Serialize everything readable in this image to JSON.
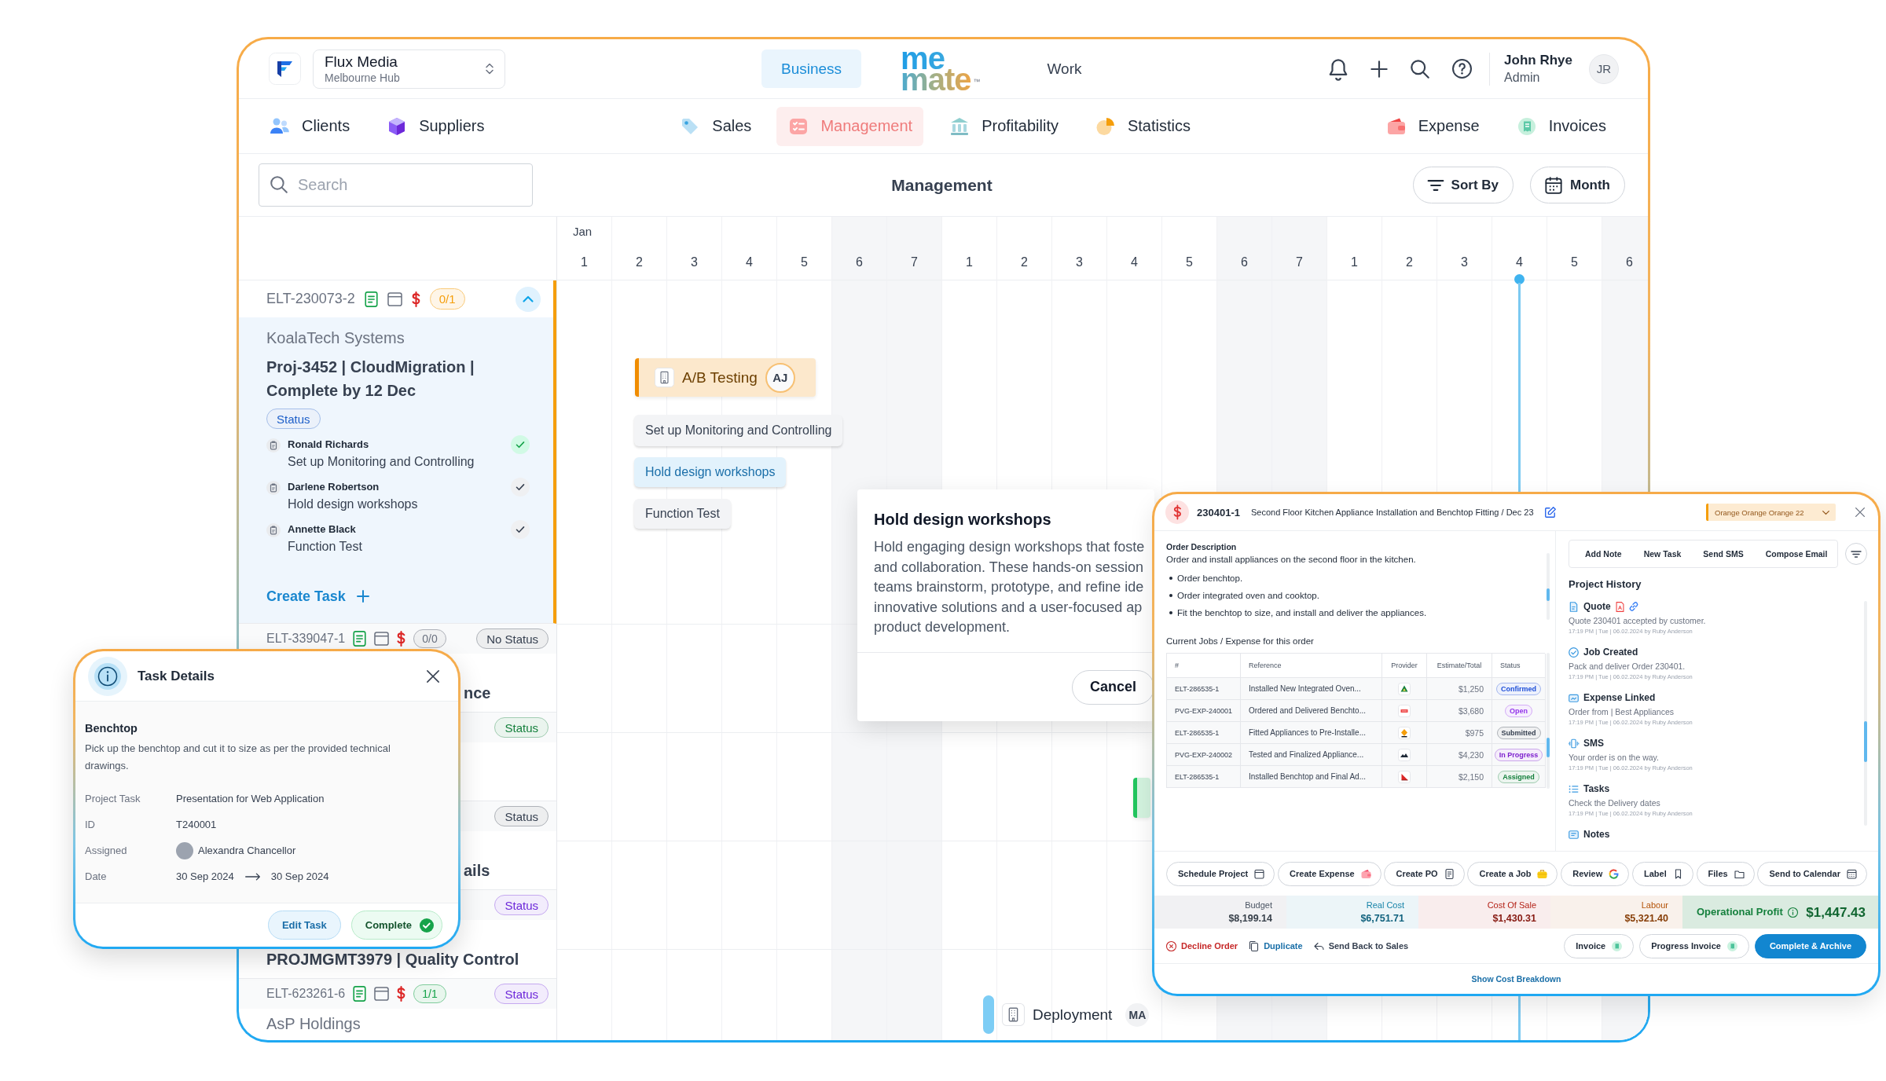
{
  "header": {
    "org": {
      "name": "Flux Media",
      "location": "Melbourne Hub"
    },
    "modes": [
      {
        "label": "Business",
        "selected": true
      },
      {
        "label": "Work",
        "selected": false
      }
    ],
    "logo": {
      "top": "me",
      "bottom": "mate",
      "mark": "™"
    },
    "user": {
      "name": "John Rhye",
      "role": "Admin",
      "initials": "JR"
    }
  },
  "nav": {
    "left": [
      {
        "label": "Clients",
        "selected": false
      },
      {
        "label": "Suppliers",
        "selected": false
      }
    ],
    "center": [
      {
        "label": "Sales",
        "selected": false
      },
      {
        "label": "Management",
        "selected": true
      },
      {
        "label": "Profitability",
        "selected": false
      },
      {
        "label": "Statistics",
        "selected": false
      }
    ],
    "right": [
      {
        "label": "Expense",
        "selected": false
      },
      {
        "label": "Invoices",
        "selected": false
      }
    ]
  },
  "toolbar": {
    "search": {
      "placeholder": "Search"
    },
    "title": "Management",
    "buttons": [
      "Sort By",
      "Month"
    ]
  },
  "timeline": {
    "month": "Jan",
    "days": [
      {
        "label": "1",
        "weekend": false,
        "today": false
      },
      {
        "label": "2",
        "weekend": false,
        "today": false
      },
      {
        "label": "3",
        "weekend": false,
        "today": false
      },
      {
        "label": "4",
        "weekend": false,
        "today": false
      },
      {
        "label": "5",
        "weekend": false,
        "today": false
      },
      {
        "label": "6",
        "weekend": true,
        "today": false
      },
      {
        "label": "7",
        "weekend": true,
        "today": false
      },
      {
        "label": "1",
        "weekend": false,
        "today": false
      },
      {
        "label": "2",
        "weekend": false,
        "today": false
      },
      {
        "label": "3",
        "weekend": false,
        "today": false
      },
      {
        "label": "4",
        "weekend": false,
        "today": false
      },
      {
        "label": "5",
        "weekend": false,
        "today": false
      },
      {
        "label": "6",
        "weekend": true,
        "today": false
      },
      {
        "label": "7",
        "weekend": true,
        "today": false
      },
      {
        "label": "1",
        "weekend": false,
        "today": false
      },
      {
        "label": "2",
        "weekend": false,
        "today": false
      },
      {
        "label": "3",
        "weekend": false,
        "today": false
      },
      {
        "label": "4",
        "weekend": false,
        "today": true
      },
      {
        "label": "5",
        "weekend": false,
        "today": false
      },
      {
        "label": "6",
        "weekend": true,
        "today": false
      }
    ]
  },
  "projects": [
    {
      "id": "ELT-230073-2",
      "badge": {
        "text": "0/1",
        "color": "#f59e0b"
      },
      "expanded": true,
      "client": "KoalaTech Systems",
      "title": "Proj-3452 | CloudMigration | Complete by 12 Dec",
      "status": {
        "text": "Status",
        "color": "#1d5fc9"
      },
      "tasks": [
        {
          "assignee": "Ronald Richards",
          "name": "Set up Monitoring and Controlling",
          "checked": true
        },
        {
          "assignee": "Darlene Robertson",
          "name": "Hold design workshops",
          "checked": false
        },
        {
          "assignee": "Annette Black",
          "name": "Function Test",
          "checked": false
        }
      ],
      "create_label": "Create Task"
    },
    {
      "id": "ELT-339047-1",
      "badge": {
        "text": "0/0",
        "color": "#6b7280"
      },
      "expanded": false,
      "status": {
        "text": "No Status",
        "color": "#374151"
      },
      "title": "nce"
    },
    {
      "expanded": false,
      "status": {
        "text": "Status",
        "color": "#15803d"
      }
    },
    {
      "expanded": false,
      "status": {
        "text": "Status",
        "color": "#374151"
      },
      "title": "ails"
    },
    {
      "expanded": false,
      "status": {
        "text": "Status",
        "color": "#6d28d9"
      },
      "title": "PROJMGMT3979 | Quality Control"
    },
    {
      "id": "ELT-623261-6",
      "badge": {
        "text": "1/1",
        "color": "#16a34a"
      },
      "expanded": false,
      "status": {
        "text": "Status",
        "color": "#6d28d9"
      },
      "client": "AsP Holdings"
    }
  ],
  "gantt_bars": [
    {
      "kind": "milestone",
      "label": "A/B Testing",
      "initials": "AJ",
      "color": "#f08c00",
      "selected": false
    },
    {
      "kind": "task",
      "label": "Set up Monitoring and Controlling",
      "selected": false
    },
    {
      "kind": "task",
      "label": "Hold design workshops",
      "selected": true
    },
    {
      "kind": "task",
      "label": "Function Test",
      "selected": false
    },
    {
      "kind": "milestone",
      "color": "#22c55e",
      "selected": false
    },
    {
      "kind": "event",
      "label": "Deployment",
      "initials": "MA",
      "color": "#7dcdf5",
      "selected": false
    }
  ],
  "task_popover": {
    "title": "Hold design workshops",
    "text": "Hold engaging design workshops that foste\nand collaboration. These hands-on session\nteams brainstorm, prototype, and refine ide\ninnovative solutions and a user-focused ap\nproduct development.",
    "button": "Cancel"
  },
  "order": {
    "id": "230401-1",
    "title": "Second Floor Kitchen Appliance Installation and Benchtop Fitting / Dec 23",
    "tag": "Orange Orange Orange 22",
    "description_heading": "Order Description",
    "description": "Order and install appliances on the second floor in the kitchen.",
    "bullets": [
      "Order benchtop.",
      "Order integrated oven and cooktop.",
      "Fit the benchtop to size, and install and deliver the appliances."
    ],
    "jobs_heading": "Current Jobs / Expense for this order",
    "jobs_columns": [
      "#",
      "Reference",
      "Provider",
      "Estimate/Total",
      "Status"
    ],
    "jobs": [
      {
        "number": "ELT-286535-1",
        "reference": "Installed New Integrated Oven...",
        "total": "$1,250",
        "status": "Confirmed",
        "color": "#1d4ed8"
      },
      {
        "number": "PVG-EXP-240001",
        "reference": "Ordered and Delivered Benchto...",
        "total": "$3,680",
        "status": "Open",
        "color": "#9333ea"
      },
      {
        "number": "ELT-286535-1",
        "reference": "Fitted Appliances to Pre-Installe...",
        "total": "$975",
        "status": "Submitted",
        "color": "#374151"
      },
      {
        "number": "PVG-EXP-240002",
        "reference": "Tested and Finalized Appliance...",
        "total": "$4,230",
        "status": "In Progress",
        "color": "#7e22ce"
      },
      {
        "number": "ELT-286535-1",
        "reference": "Installed Benchtop and Final Ad...",
        "total": "$2,150",
        "status": "Assigned",
        "color": "#15803d"
      }
    ],
    "tabs": [
      "Add Note",
      "New Task",
      "Send SMS",
      "Compose Email"
    ],
    "history_heading": "Project History",
    "history": [
      {
        "title": "Quote",
        "text": "Quote 230401 accepted by customer.",
        "meta": "17:19 PM | Tue | 06.02.2024 by Ruby Anderson"
      },
      {
        "title": "Job Created",
        "text": "Pack and deliver Order 230401.",
        "meta": "17:19 PM | Tue | 06.02.2024 by Ruby Anderson"
      },
      {
        "title": "Expense Linked",
        "text": "Order from | Best Appliances",
        "meta": "17:19 PM | Tue | 06.02.2024 by Ruby Anderson"
      },
      {
        "title": "SMS",
        "text": "Your order is on the way.",
        "meta": "17:19 PM | Tue | 06.02.2024 by Ruby Anderson"
      },
      {
        "title": "Tasks",
        "text": "Check the Delivery dates",
        "meta": "17:19 PM | Tue | 06.02.2024 by Ruby Anderson"
      },
      {
        "title": "Notes"
      }
    ],
    "actions": [
      "Schedule Project",
      "Create Expense",
      "Create PO",
      "Create a Job",
      "Review",
      "Label",
      "Files",
      "Send to Calendar"
    ],
    "summary": [
      {
        "kind": "cost",
        "label": "Budget",
        "value": "$8,199.14",
        "color": "#4b5563"
      },
      {
        "kind": "cost",
        "label": "Real Cost",
        "value": "$6,751.71",
        "color": "#1683a8"
      },
      {
        "kind": "cost",
        "label": "Cost Of Sale",
        "value": "$1,430.31",
        "color": "#b42318"
      },
      {
        "kind": "cost",
        "label": "Labour",
        "value": "$5,321.40",
        "color": "#b45309"
      },
      {
        "kind": "total",
        "label": "Operational Profit",
        "value": "$1,447.43",
        "color": "#15803d"
      }
    ],
    "links": [
      {
        "label": "Decline Order",
        "color": "#c62828"
      },
      {
        "label": "Duplicate",
        "color": "#1a6fa8"
      },
      {
        "label": "Send Back to Sales",
        "color": "#374151"
      }
    ],
    "footer_buttons": [
      {
        "label": "Invoice",
        "primary": false
      },
      {
        "label": "Progress Invoice",
        "primary": false
      },
      {
        "label": "Complete & Archive",
        "primary": true
      }
    ],
    "breakdown": "Show Cost Breakdown"
  },
  "task_details": {
    "title": "Task Details",
    "name": "Benchtop",
    "description": "Pick up the benchtop and cut it to size as per the provided technical drawings.",
    "fields": [
      {
        "kind": "text",
        "label": "Project Task",
        "value": "Presentation for Web Application"
      },
      {
        "kind": "text",
        "label": "ID",
        "value": "T240001"
      },
      {
        "kind": "person",
        "label": "Assigned",
        "value": "Alexandra Chancellor"
      },
      {
        "kind": "range",
        "label": "Date",
        "start": "30 Sep 2024",
        "end": "30 Sep 2024"
      }
    ],
    "buttons": [
      {
        "kind": "secondary",
        "label": "Edit Task"
      },
      {
        "kind": "success",
        "label": "Complete"
      }
    ]
  }
}
